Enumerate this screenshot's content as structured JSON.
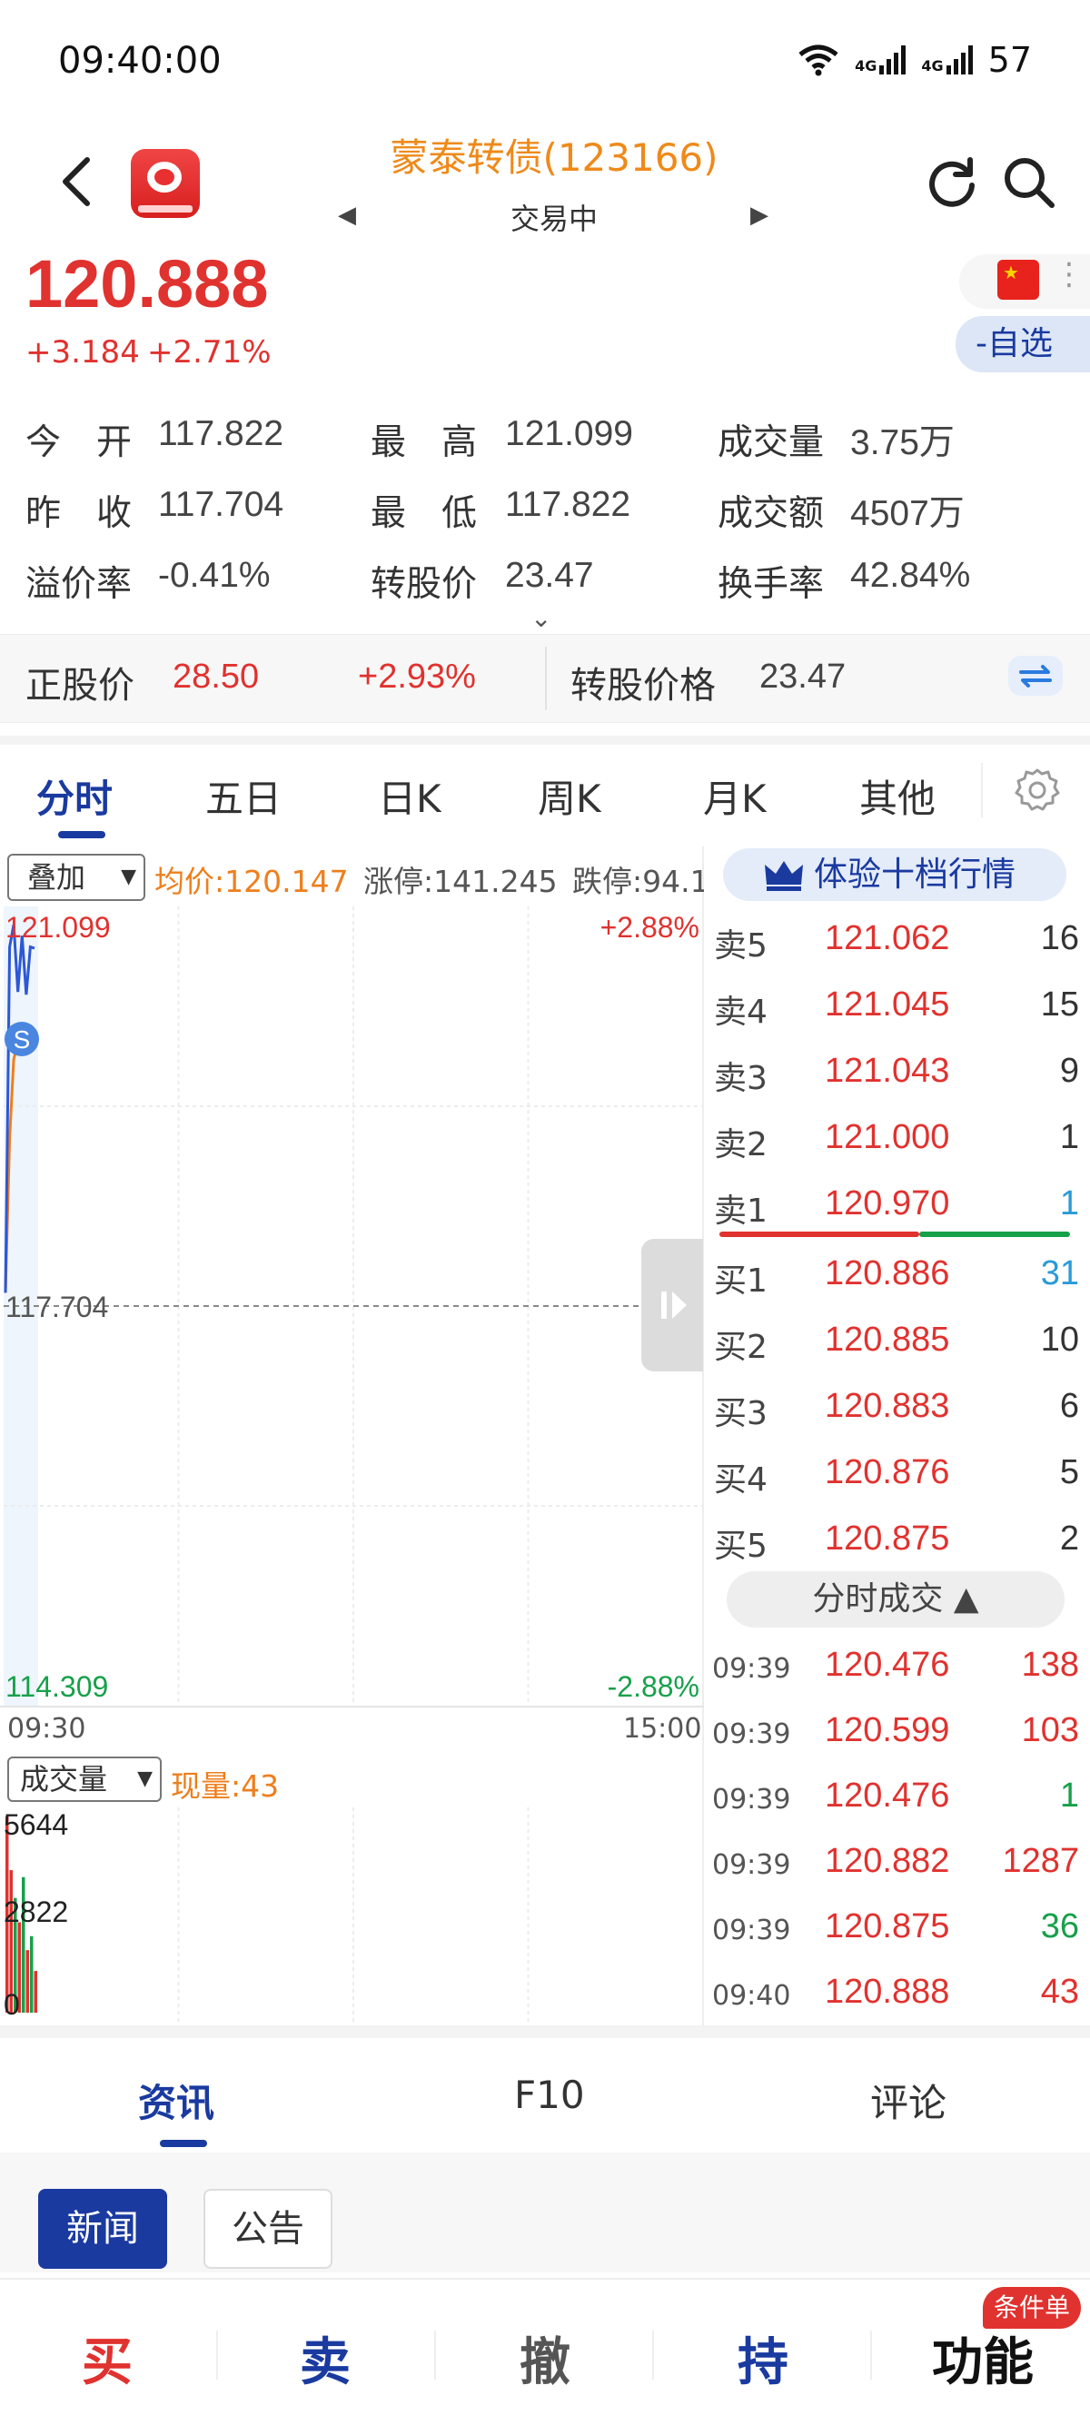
{
  "status_bar": {
    "time": "09:40:00",
    "battery": "57",
    "net1": "4G",
    "net2": "4G"
  },
  "header": {
    "title": "蒙泰转债(123166)",
    "trade_status": "交易中",
    "prev": "◀",
    "next": "▶"
  },
  "quote": {
    "price": "120.888",
    "change": "+3.184",
    "change_pct": "+2.71%",
    "watch_label": "-自选"
  },
  "stats": [
    {
      "label": "今　开",
      "value": "117.822"
    },
    {
      "label": "最　高",
      "value": "121.099"
    },
    {
      "label": "成交量",
      "value": "3.75万"
    },
    {
      "label": "昨　收",
      "value": "117.704"
    },
    {
      "label": "最　低",
      "value": "117.822"
    },
    {
      "label": "成交额",
      "value": "4507万"
    },
    {
      "label": "溢价率",
      "value": "-0.41%"
    },
    {
      "label": "转股价",
      "value": "23.47"
    },
    {
      "label": "换手率",
      "value": "42.84%"
    }
  ],
  "stock_strip": {
    "stock_label": "正股价",
    "stock_price": "28.50",
    "stock_pct": "+2.93%",
    "conv_label": "转股价格",
    "conv_price": "23.47"
  },
  "chart_tabs": [
    "分时",
    "五日",
    "日K",
    "周K",
    "月K",
    "其他"
  ],
  "chart_header": {
    "overlay": "叠加",
    "avg": "均价:120.147",
    "limit_up": "涨停:141.245",
    "limit_down": "跌停:94.1",
    "vol_select": "成交量",
    "cur_vol": "现量:43",
    "time_start": "09:30",
    "time_end": "15:00"
  },
  "chart_data": {
    "type": "line",
    "y_max_label": "121.099",
    "y_mid_label": "117.704",
    "y_min_label": "114.309",
    "pct_max_label": "+2.88%",
    "pct_min_label": "-2.88%",
    "ylim": [
      114.309,
      121.099
    ],
    "prev_close": 117.704,
    "x_range": [
      "09:30",
      "15:00"
    ],
    "series": [
      {
        "values": [
          117.822,
          120.9,
          121.099,
          120.5,
          121.0,
          120.476,
          120.9,
          120.888
        ]
      },
      {
        "values": [
          117.822,
          119.2,
          119.9,
          120.05,
          120.1,
          120.12,
          120.14,
          120.147
        ]
      }
    ],
    "marker": "S",
    "volume": {
      "labels": [
        "5644",
        "2822",
        "0"
      ],
      "ylim": [
        0,
        5644
      ],
      "bars": [
        {
          "v": 5644,
          "up": true
        },
        {
          "v": 4100,
          "up": true
        },
        {
          "v": 3300,
          "up": false
        },
        {
          "v": 2600,
          "up": true
        },
        {
          "v": 3900,
          "up": false
        },
        {
          "v": 1800,
          "up": true
        },
        {
          "v": 2200,
          "up": false
        },
        {
          "v": 1200,
          "up": true
        }
      ]
    }
  },
  "order_book": {
    "badge": "体验十档行情",
    "asks": [
      {
        "label": "卖5",
        "price": "121.062",
        "vol": "16"
      },
      {
        "label": "卖4",
        "price": "121.045",
        "vol": "15"
      },
      {
        "label": "卖3",
        "price": "121.043",
        "vol": "9"
      },
      {
        "label": "卖2",
        "price": "121.000",
        "vol": "1"
      },
      {
        "label": "卖1",
        "price": "120.970",
        "vol": "1"
      }
    ],
    "bids": [
      {
        "label": "买1",
        "price": "120.886",
        "vol": "31"
      },
      {
        "label": "买2",
        "price": "120.885",
        "vol": "10"
      },
      {
        "label": "买3",
        "price": "120.883",
        "vol": "6"
      },
      {
        "label": "买4",
        "price": "120.876",
        "vol": "5"
      },
      {
        "label": "买5",
        "price": "120.875",
        "vol": "2"
      }
    ],
    "ticks_badge": "分时成交 ▲",
    "ticks": [
      {
        "time": "09:39",
        "price": "120.476",
        "vol": "138",
        "color": "red"
      },
      {
        "time": "09:39",
        "price": "120.599",
        "vol": "103",
        "color": "red"
      },
      {
        "time": "09:39",
        "price": "120.476",
        "vol": "1",
        "color": "green"
      },
      {
        "time": "09:39",
        "price": "120.882",
        "vol": "1287",
        "color": "red"
      },
      {
        "time": "09:39",
        "price": "120.875",
        "vol": "36",
        "color": "green"
      },
      {
        "time": "09:40",
        "price": "120.888",
        "vol": "43",
        "color": "red"
      }
    ]
  },
  "info_tabs": [
    "资讯",
    "F10",
    "评论"
  ],
  "info_chips": [
    "新闻",
    "公告"
  ],
  "bottom_bar": {
    "buy": "买",
    "sell": "卖",
    "cancel": "撤",
    "hold": "持",
    "func": "功能",
    "badge": "条件单"
  },
  "colors": {
    "up": "#e0322f",
    "down": "#17a04a",
    "accent": "#1a3aa0",
    "avg_line": "#ee7f1c"
  },
  "icons": [
    "back-icon",
    "refresh-icon",
    "search-icon",
    "flag-icon",
    "settings-icon",
    "crown-icon",
    "swap-icon"
  ]
}
